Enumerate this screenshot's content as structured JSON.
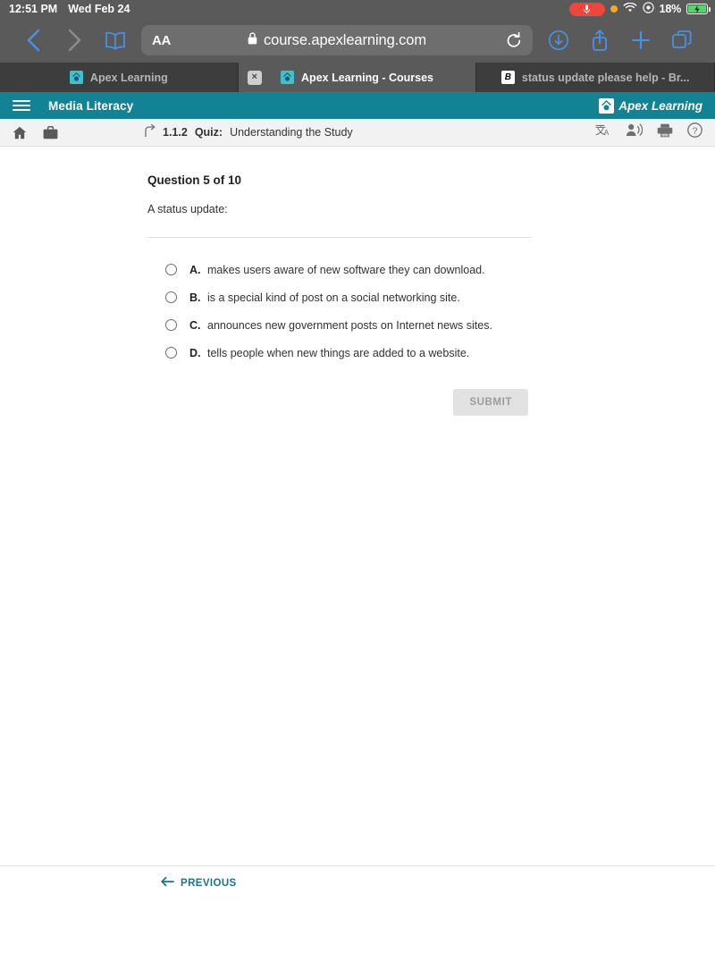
{
  "status_bar": {
    "time": "12:51 PM",
    "date": "Wed Feb 24",
    "mic_icon": "microphone-icon",
    "recording_dot": "orange-recording-dot",
    "wifi_icon": "wifi-icon",
    "location_icon": "location-icon",
    "battery_percent": "18%",
    "battery_icon": "battery-charging-icon"
  },
  "browser": {
    "back_icon": "chevron-left-icon",
    "forward_icon": "chevron-right-icon",
    "bookmarks_icon": "book-icon",
    "text_size_label": "AA",
    "lock_icon": "lock-icon",
    "url": "course.apexlearning.com",
    "reload_icon": "reload-icon",
    "downloads_icon": "download-circle-icon",
    "share_icon": "share-icon",
    "new_tab_icon": "plus-icon",
    "tabs_icon": "tabs-overview-icon",
    "tabs": [
      {
        "label": "Apex Learning",
        "favicon": "apex-favicon",
        "active": false,
        "closable": false
      },
      {
        "label": "Apex Learning - Courses",
        "favicon": "apex-favicon",
        "active": true,
        "closable": true,
        "close_label": "×"
      },
      {
        "label": "status update please help - Br...",
        "favicon": "brainly-favicon",
        "favicon_letter": "B",
        "active": false,
        "closable": false
      }
    ]
  },
  "apex_header": {
    "menu_icon": "hamburger-menu-icon",
    "course_title": "Media Literacy",
    "logo_text": "Apex Learning",
    "logo_mark": "apex-logo-mark",
    "background_color": "#128295"
  },
  "crumb_bar": {
    "home_icon": "home-icon",
    "briefcase_icon": "briefcase-icon",
    "up_level_icon": "up-level-arrow-icon",
    "lesson_number": "1.1.2",
    "activity_type": "Quiz:",
    "activity_name": "Understanding the Study",
    "translate_icon": "translate-icon",
    "read_aloud_icon": "read-aloud-icon",
    "print_icon": "print-icon",
    "help_icon": "help-icon"
  },
  "quiz": {
    "question_heading": "Question 5 of 10",
    "question_stem": "A status update:",
    "options": [
      {
        "letter": "A.",
        "text": "makes users aware of new software they can download."
      },
      {
        "letter": "B.",
        "text": "is a special kind of post on a social networking site."
      },
      {
        "letter": "C.",
        "text": "announces new government posts on Internet news sites."
      },
      {
        "letter": "D.",
        "text": "tells people when new things are added to a website."
      }
    ],
    "submit_label": "SUBMIT",
    "submit_enabled": false
  },
  "footer": {
    "previous_label": "PREVIOUS",
    "previous_icon": "arrow-left-icon",
    "accent_color": "#15778c"
  }
}
